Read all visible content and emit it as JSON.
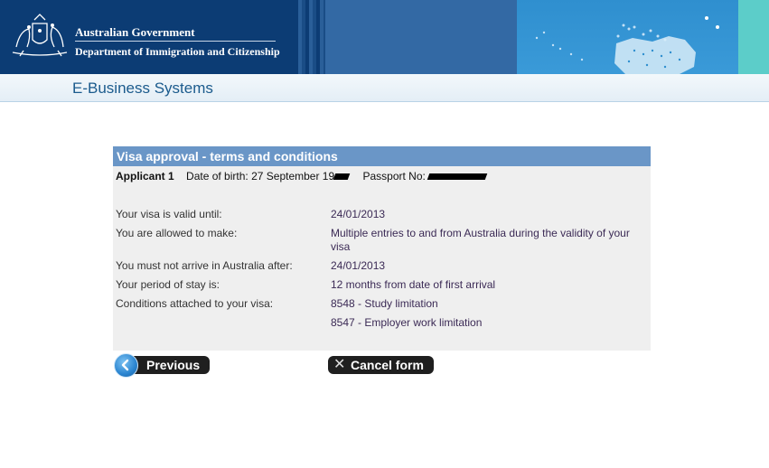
{
  "header": {
    "gov_title": "Australian Government",
    "dept_title": "Department of Immigration and Citizenship"
  },
  "subheader": {
    "system_title": "E-Business Systems"
  },
  "panel": {
    "title": "Visa approval - terms and conditions",
    "applicant": {
      "label": "Applicant 1",
      "dob_label": "Date of birth:",
      "dob_value": "27 September 19",
      "passport_label": "Passport No:"
    },
    "rows": [
      {
        "label": "Your visa is valid until:",
        "value": "24/01/2013"
      },
      {
        "label": "You are allowed to make:",
        "value": "Multiple entries to and from Australia during the validity of your visa"
      },
      {
        "label": "You must not arrive in Australia after:",
        "value": "24/01/2013"
      },
      {
        "label": "Your period of stay is:",
        "value": "12 months from date of first arrival"
      },
      {
        "label": "Conditions attached to your visa:",
        "value": "8548 - Study limitation"
      },
      {
        "label": "",
        "value": "8547 - Employer work limitation"
      }
    ]
  },
  "buttons": {
    "previous": "Previous",
    "cancel": "Cancel form"
  },
  "colors": {
    "banner_navy": "#0c3c74",
    "panel_header": "#6a96c7",
    "panel_bg": "#efefef",
    "value_text": "#3b2a55"
  }
}
